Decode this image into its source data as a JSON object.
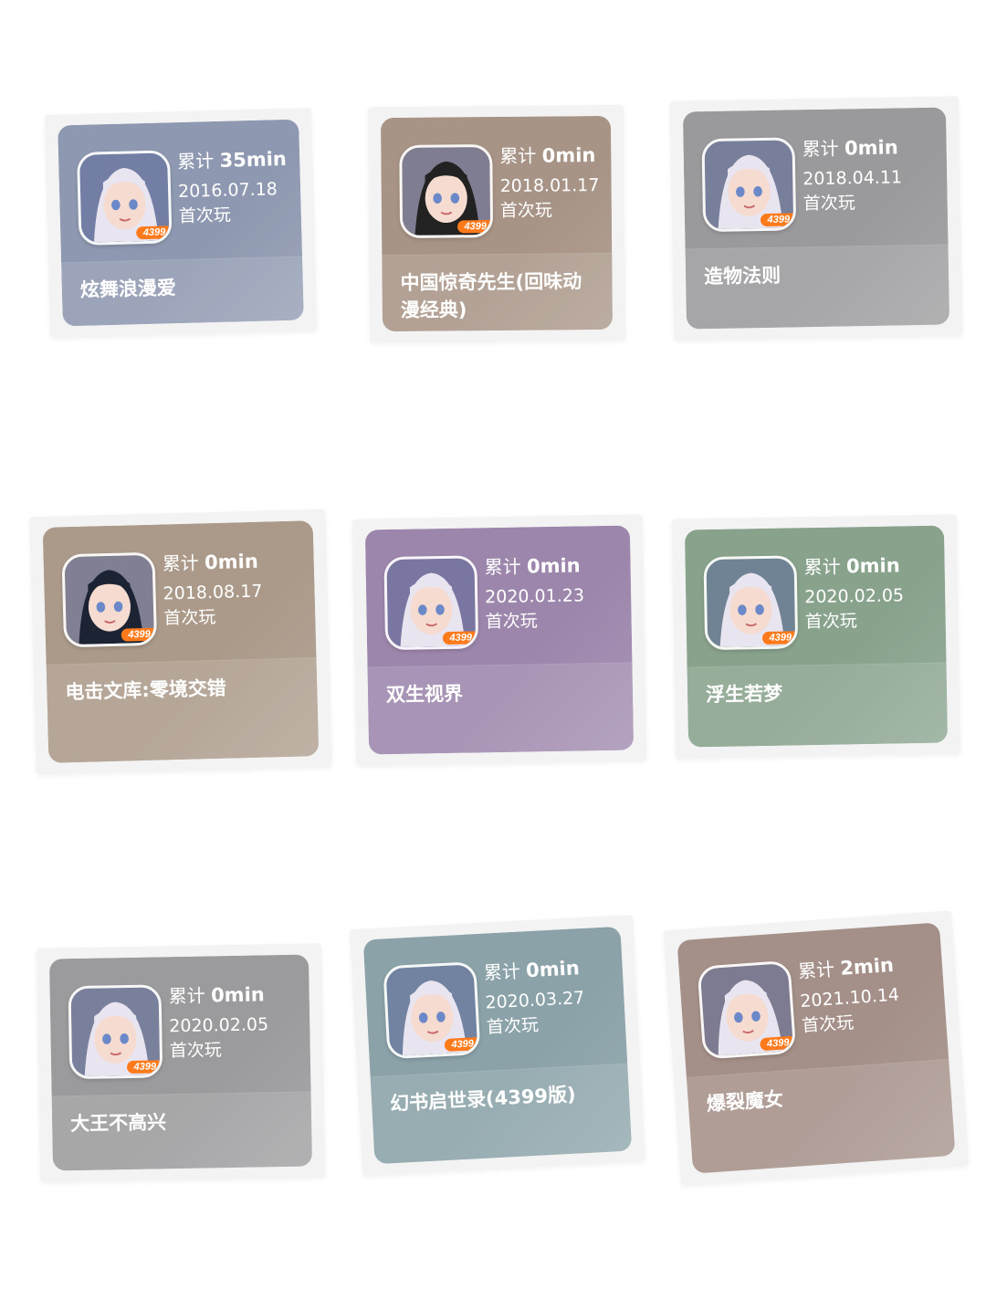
{
  "played_prefix": "累计",
  "first_play_label": "首次玩",
  "badge_text": "4399",
  "cards": [
    {
      "minutes": "35min",
      "date": "2016.07.18",
      "title": "炫舞浪漫爱",
      "color": "#8e98b0",
      "icon": "girl-avatar-icon"
    },
    {
      "minutes": "0min",
      "date": "2018.01.17",
      "title": "中国惊奇先生(回味动漫经典)",
      "color": "#a89486",
      "icon": "man-avatar-icon"
    },
    {
      "minutes": "0min",
      "date": "2018.04.11",
      "title": "造物法则",
      "color": "#9a999c",
      "icon": "girl-avatar-icon"
    },
    {
      "minutes": "0min",
      "date": "2018.08.17",
      "title": "电击文库:零境交错",
      "color": "#ab9a8a",
      "icon": "boy-avatar-icon"
    },
    {
      "minutes": "0min",
      "date": "2020.01.23",
      "title": "双生视界",
      "color": "#9d86ac",
      "icon": "girl-avatar-icon"
    },
    {
      "minutes": "0min",
      "date": "2020.02.05",
      "title": "浮生若梦",
      "color": "#88a28c",
      "icon": "girl-avatar-icon"
    },
    {
      "minutes": "0min",
      "date": "2020.02.05",
      "title": "大王不高兴",
      "color": "#9b9b9d",
      "icon": "girl-avatar-icon"
    },
    {
      "minutes": "0min",
      "date": "2020.03.27",
      "title": "幻书启世录(4399版)",
      "color": "#8aa2a8",
      "icon": "girl-avatar-icon"
    },
    {
      "minutes": "2min",
      "date": "2021.10.14",
      "title": "爆裂魔女",
      "color": "#a49088",
      "icon": "girl-avatar-icon"
    }
  ]
}
